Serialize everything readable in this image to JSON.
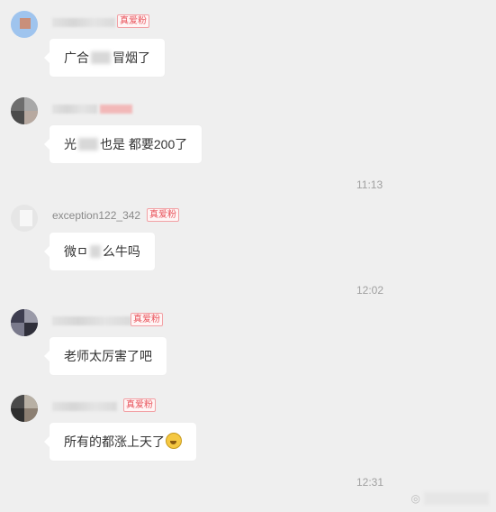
{
  "messages": [
    {
      "name": "",
      "badge": "真爱粉",
      "text_parts": [
        "广合",
        "冒烟了"
      ],
      "time": ""
    },
    {
      "name": "",
      "badge": "",
      "text_parts": [
        "光",
        "也是  都要200了"
      ],
      "time": "11:13"
    },
    {
      "name": "exception122_342",
      "badge": "真爱粉",
      "text_parts": [
        "微ㅁ",
        "么牛吗"
      ],
      "time": "12:02"
    },
    {
      "name": "",
      "badge": "真爱粉",
      "text": "老师太厉害了吧",
      "time": ""
    },
    {
      "name": "",
      "badge": "真爱粉",
      "text": "所有的都涨上天了",
      "emoji": "grimacing-face",
      "time": "12:31"
    }
  ],
  "colors": {
    "background": "#efefef",
    "bubble": "#ffffff",
    "badge_text": "#e8545c"
  }
}
